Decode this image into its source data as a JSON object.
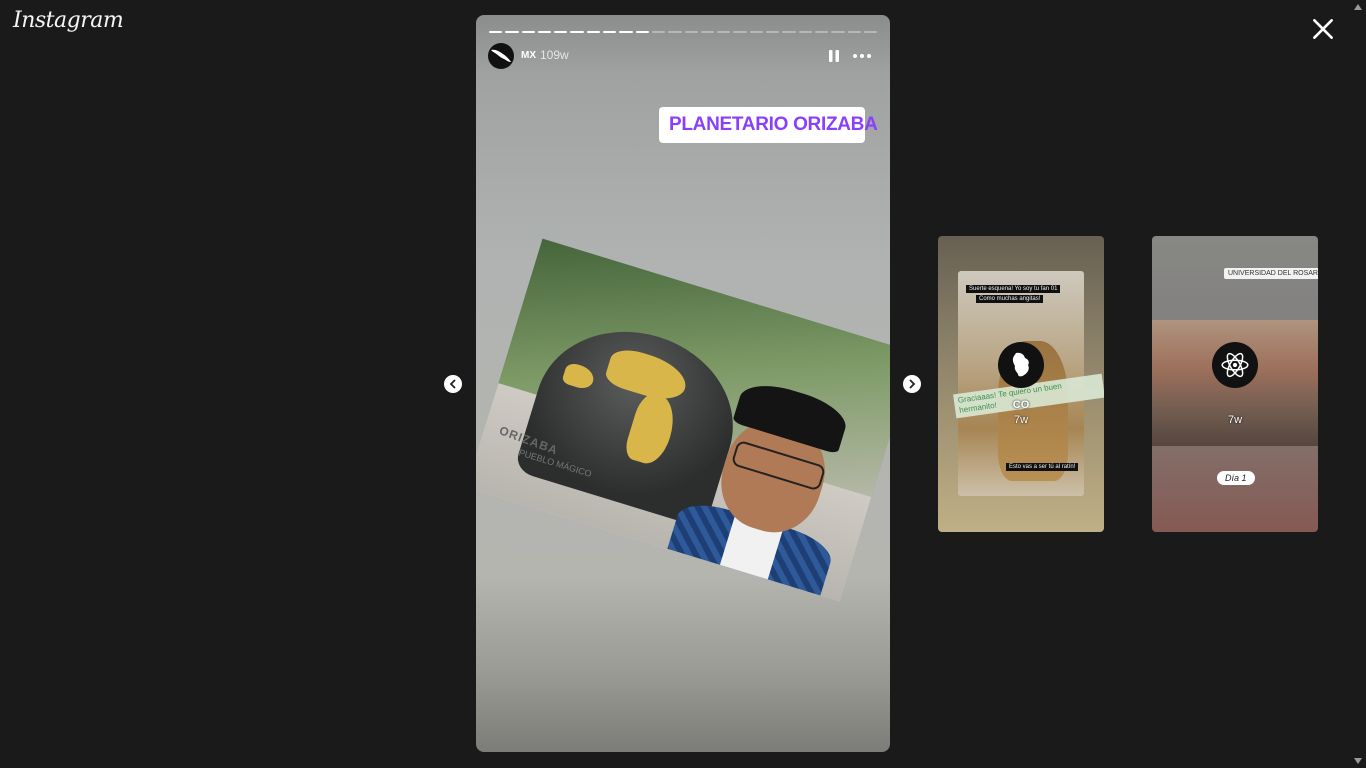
{
  "app": {
    "logo": "Instagram"
  },
  "story": {
    "username": "MX",
    "timestamp": "109w",
    "segments_total": 24,
    "segments_done": 10,
    "location_sticker": "PLANETARIO ORIZABA",
    "ground_text": "ORIZABA",
    "ground_sub": "PUEBLO MÁGICO"
  },
  "previews": [
    {
      "username": "CO",
      "timestamp": "7w",
      "sticker_lines": [
        "Suerte esquena! Yo soy tu fan 01",
        "Como muchas angitas!"
      ],
      "green_text": "Graciaaas! Te quiero un buen hermanito!",
      "label": "Esto vas a ser tú al ratín!"
    },
    {
      "username": "",
      "timestamp": "7w",
      "location": "UNIVERSIDAD DEL ROSARIO",
      "day_label": "Día 1"
    }
  ],
  "colors": {
    "location_text": "#8a3ffc",
    "background": "#1a1a1a"
  },
  "icons": {
    "close": "close-icon",
    "pause": "pause-icon",
    "more": "more-icon",
    "prev": "chevron-left-icon",
    "next": "chevron-right-icon"
  }
}
